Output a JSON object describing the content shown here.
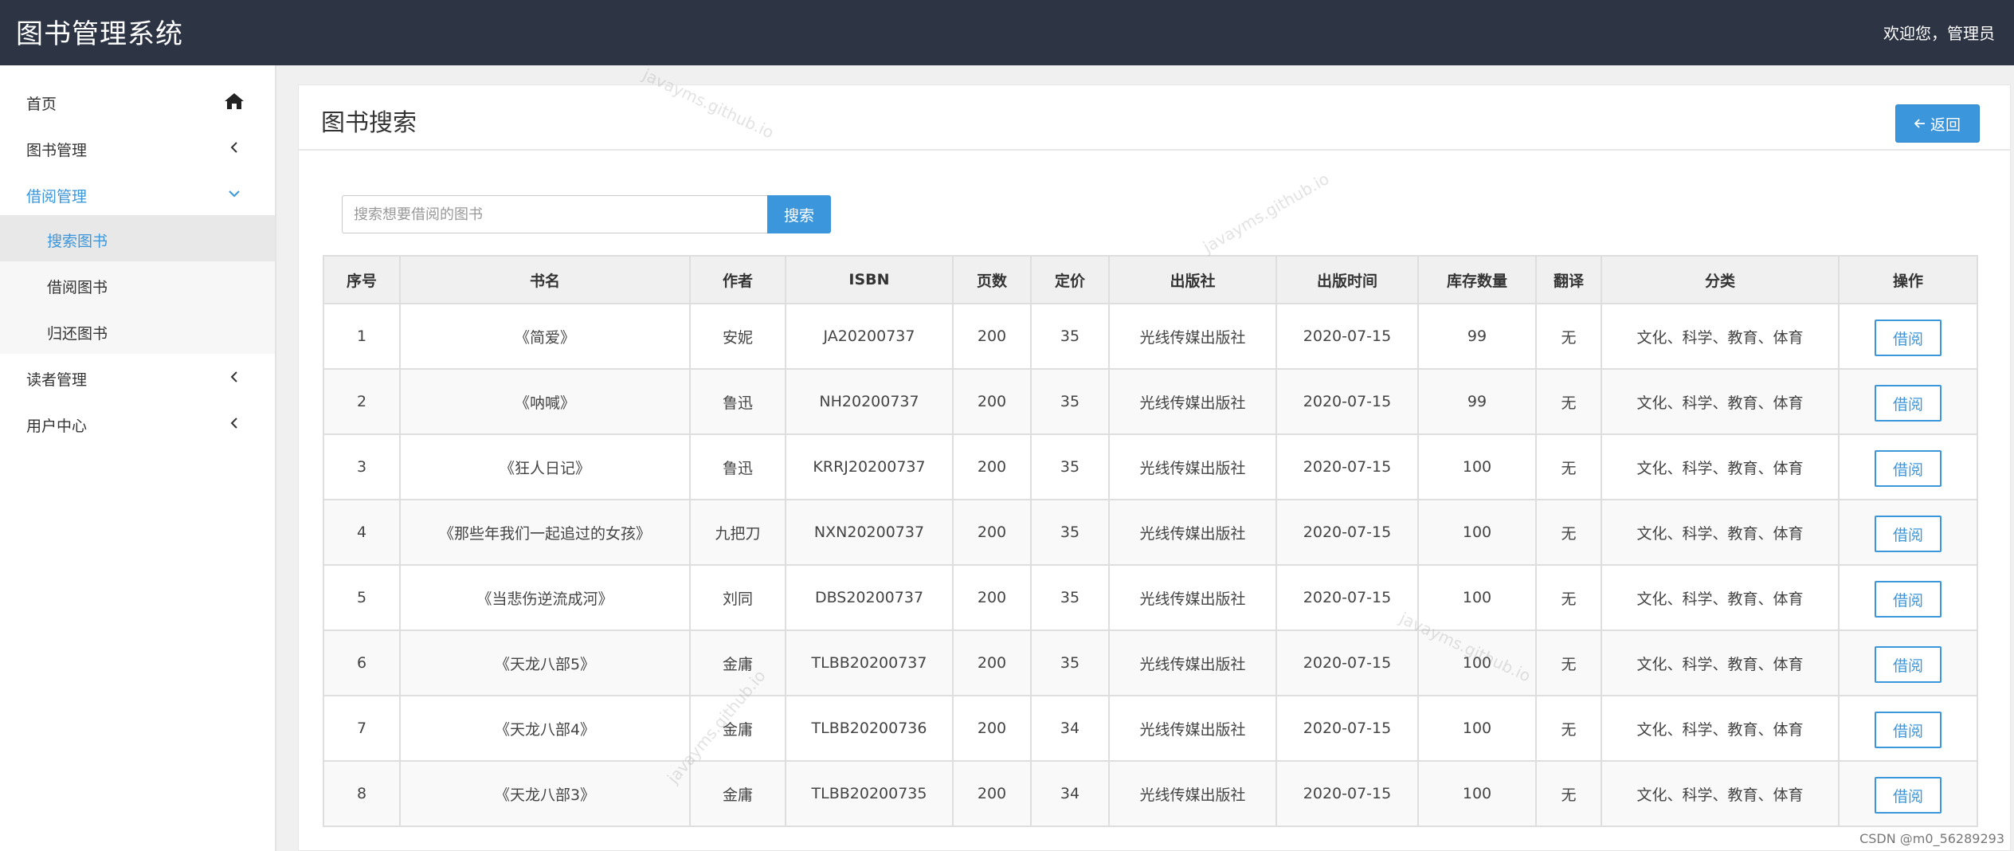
{
  "header": {
    "app_title": "图书管理系统",
    "welcome": "欢迎您，管理员"
  },
  "sidebar": {
    "items": [
      {
        "label": "首页",
        "icon": "home-icon"
      },
      {
        "label": "图书管理",
        "icon": "chevron-left-icon"
      },
      {
        "label": "借阅管理",
        "icon": "chevron-down-icon",
        "open": true
      },
      {
        "label": "读者管理",
        "icon": "chevron-left-icon"
      },
      {
        "label": "用户中心",
        "icon": "chevron-left-icon"
      }
    ],
    "subitems": [
      {
        "label": "搜索图书",
        "active": true
      },
      {
        "label": "借阅图书"
      },
      {
        "label": "归还图书"
      }
    ]
  },
  "main": {
    "title": "图书搜索",
    "back_label": "返回",
    "search": {
      "placeholder": "搜索想要借阅的图书",
      "value": "",
      "button_label": "搜索"
    }
  },
  "table": {
    "headers": [
      "序号",
      "书名",
      "作者",
      "ISBN",
      "页数",
      "定价",
      "出版社",
      "出版时间",
      "库存数量",
      "翻译",
      "分类",
      "操作"
    ],
    "rows": [
      [
        "1",
        "《简爱》",
        "安妮",
        "JA20200737",
        "200",
        "35",
        "光线传媒出版社",
        "2020-07-15",
        "99",
        "无",
        "文化、科学、教育、体育",
        "借阅"
      ],
      [
        "2",
        "《呐喊》",
        "鲁迅",
        "NH20200737",
        "200",
        "35",
        "光线传媒出版社",
        "2020-07-15",
        "99",
        "无",
        "文化、科学、教育、体育",
        "借阅"
      ],
      [
        "3",
        "《狂人日记》",
        "鲁迅",
        "KRRJ20200737",
        "200",
        "35",
        "光线传媒出版社",
        "2020-07-15",
        "100",
        "无",
        "文化、科学、教育、体育",
        "借阅"
      ],
      [
        "4",
        "《那些年我们一起追过的女孩》",
        "九把刀",
        "NXN20200737",
        "200",
        "35",
        "光线传媒出版社",
        "2020-07-15",
        "100",
        "无",
        "文化、科学、教育、体育",
        "借阅"
      ],
      [
        "5",
        "《当悲伤逆流成河》",
        "刘同",
        "DBS20200737",
        "200",
        "35",
        "光线传媒出版社",
        "2020-07-15",
        "100",
        "无",
        "文化、科学、教育、体育",
        "借阅"
      ],
      [
        "6",
        "《天龙八部5》",
        "金庸",
        "TLBB20200737",
        "200",
        "35",
        "光线传媒出版社",
        "2020-07-15",
        "100",
        "无",
        "文化、科学、教育、体育",
        "借阅"
      ],
      [
        "7",
        "《天龙八部4》",
        "金庸",
        "TLBB20200736",
        "200",
        "34",
        "光线传媒出版社",
        "2020-07-15",
        "100",
        "无",
        "文化、科学、教育、体育",
        "借阅"
      ],
      [
        "8",
        "《天龙八部3》",
        "金庸",
        "TLBB20200735",
        "200",
        "34",
        "光线传媒出版社",
        "2020-07-15",
        "100",
        "无",
        "文化、科学、教育、体育",
        "借阅"
      ]
    ]
  },
  "overlay": {
    "watermark_text": "javayms.github.io",
    "csdn_text": "CSDN @m0_56289293"
  },
  "colors": {
    "topbar": "#2d3444",
    "accent": "#3b96db"
  }
}
